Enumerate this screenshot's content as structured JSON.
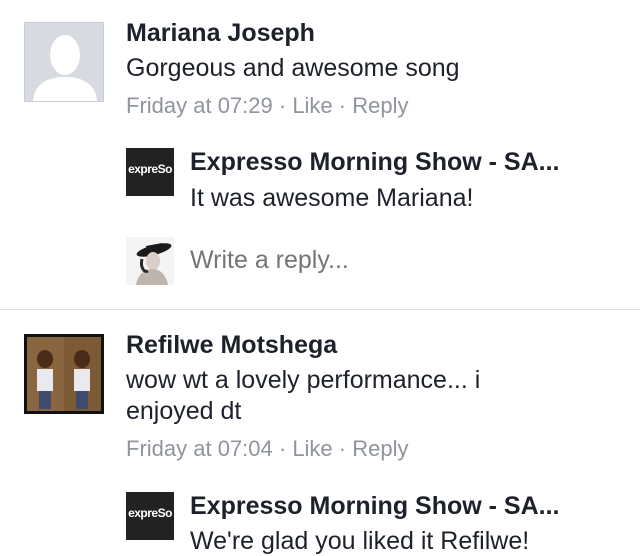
{
  "comments": [
    {
      "author": "Mariana Joseph",
      "text": "Gorgeous and awesome song",
      "time": "Friday at 07:29",
      "like_label": "Like",
      "reply_label": "Reply",
      "separator": " · ",
      "reply": {
        "author": "Expresso Morning Show - SA...",
        "text": "It was awesome Mariana!",
        "brand": "expreSo"
      }
    },
    {
      "author": "Refilwe Motshega",
      "text_line1": "wow wt a lovely performance... i",
      "text_line2": "enjoyed dt",
      "time": "Friday at 07:04",
      "like_label": "Like",
      "reply_label": "Reply",
      "separator": " · ",
      "reply": {
        "author": "Expresso Morning Show - SA...",
        "text": "We're glad you liked it Refilwe!",
        "brand": "expreSo"
      }
    }
  ],
  "write_reply": {
    "placeholder": "Write a reply..."
  },
  "icons": {
    "default_avatar": "person-silhouette-icon",
    "brand_logo": "expresso-logo-icon"
  }
}
